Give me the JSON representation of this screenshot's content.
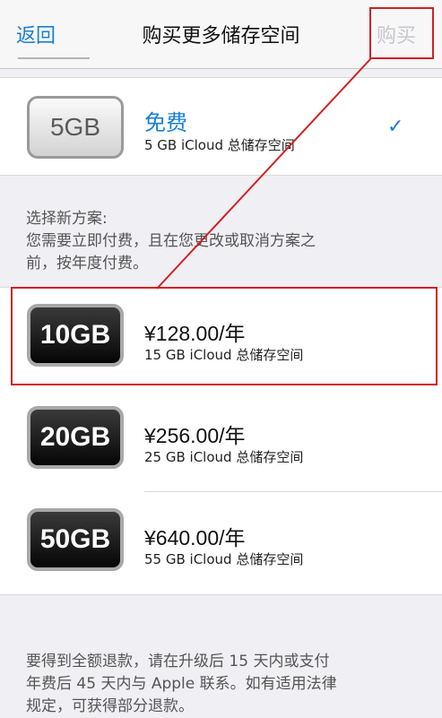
{
  "navbar": {
    "back_label": "返回",
    "title": "购买更多储存空间",
    "buy_label": "购买"
  },
  "current_plan": {
    "badge": "5GB",
    "name": "免费",
    "description": "5 GB iCloud 总储存空间",
    "check": "✓"
  },
  "note": {
    "lines": [
      "选择新方案:",
      "您需要立即付费，且在您更改或取消方案之",
      "前，按年度付费。"
    ]
  },
  "plans": [
    {
      "badge": "10GB",
      "price": "¥128.00/年",
      "storage": "15 GB iCloud 总储存空间"
    },
    {
      "badge": "20GB",
      "price": "¥256.00/年",
      "storage": "25 GB iCloud 总储存空间"
    },
    {
      "badge": "50GB",
      "price": "¥640.00/年",
      "storage": "55 GB iCloud 总储存空间"
    }
  ],
  "footer": {
    "lines": [
      "要得到全额退款，请在升级后 15 天内或支付",
      "年费后 45 天内与 Apple 联系。如有适用法律",
      "规定，可获得部分退款。"
    ]
  },
  "colors": {
    "accent": "#1a7fd3",
    "highlight": "#d42020"
  }
}
